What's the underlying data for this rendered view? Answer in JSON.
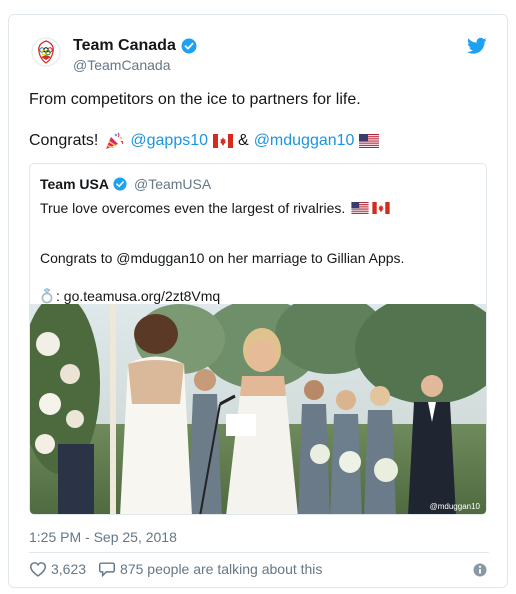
{
  "account": {
    "display_name": "Team Canada",
    "handle": "@TeamCanada",
    "logo_icon": "olympic-rings-logo"
  },
  "tweet": {
    "line1": "From competitors on the ice to partners for life.",
    "congrats": "Congrats!",
    "mention1": "@gapps10",
    "ampersand": "&",
    "mention2": "@mduggan10"
  },
  "quoted": {
    "display_name": "Team USA",
    "handle": "@TeamUSA",
    "line1": "True love overcomes even the largest of rivalries.",
    "line2": "Congrats to @mduggan10 on her marriage to Gillian Apps.",
    "link": ": go.teamusa.org/2zt8Vmq",
    "photo_credit": "@mduggan10"
  },
  "meta": {
    "timestamp": "1:25 PM - Sep 25, 2018",
    "likes": "3,623",
    "talking": "875 people are talking about this"
  },
  "colors": {
    "link": "#1b95e0",
    "muted": "#657786",
    "border": "#e1e8ed",
    "twitter_blue": "#1da1f2"
  }
}
